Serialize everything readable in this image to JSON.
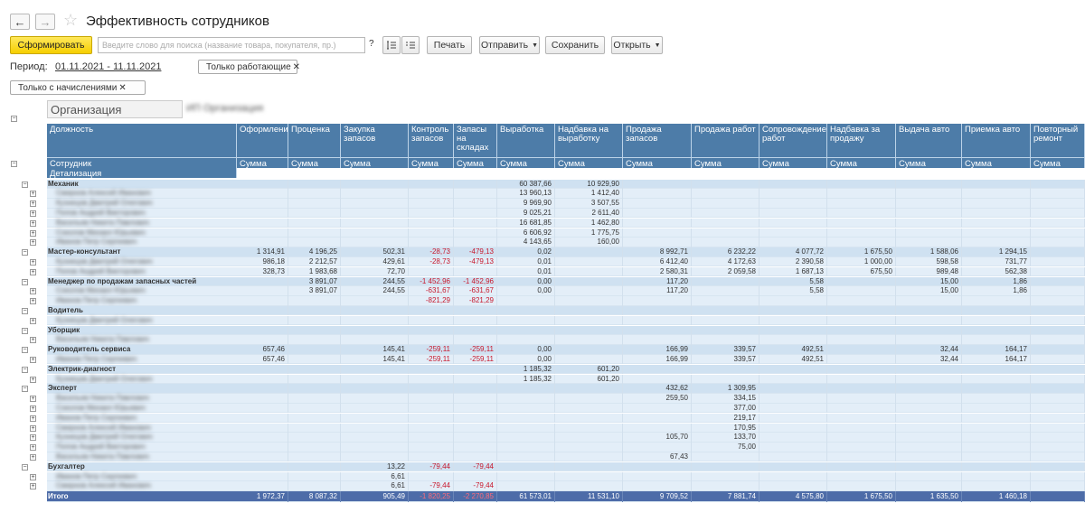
{
  "window": {
    "title": "Эффективность сотрудников"
  },
  "toolbar": {
    "generate": "Сформировать",
    "search_placeholder": "Введите слово для поиска (название товара, покупателя, пр.)",
    "help": "?",
    "print": "Печать",
    "send": "Отправить",
    "save": "Сохранить",
    "open": "Открыть"
  },
  "filters": {
    "period_label": "Период:",
    "period_value": "01.11.2021 - 11.11.2021",
    "only_working": "Только работающие",
    "only_accrued": "Только с начислениями"
  },
  "report": {
    "org_label": "Организация",
    "col_position": "Должность",
    "col_employee": "Сотрудник",
    "col_detail": "Детализация",
    "sum_label": "Сумма",
    "columns": [
      "Оформление",
      "Проценка",
      "Закупка запасов",
      "Контроль запасов",
      "Запасы на складах",
      "Выработка",
      "Надбавка на выработку",
      "Продажа запасов",
      "Продажа работ",
      "Сопровождение работ",
      "Надбавка за продажу",
      "Выдача авто",
      "Приемка авто",
      "Повторный ремонт"
    ],
    "rows": [
      {
        "kind": "group",
        "label": "Механик",
        "v": [
          "",
          "",
          "",
          "",
          "",
          "60 387,66",
          "10 929,90",
          "",
          "",
          "",
          "",
          "",
          "",
          ""
        ]
      },
      {
        "kind": "emp",
        "v": [
          "",
          "",
          "",
          "",
          "",
          "13 960,13",
          "1 412,40",
          "",
          "",
          "",
          "",
          "",
          "",
          ""
        ]
      },
      {
        "kind": "emp",
        "v": [
          "",
          "",
          "",
          "",
          "",
          "9 969,90",
          "3 507,55",
          "",
          "",
          "",
          "",
          "",
          "",
          ""
        ]
      },
      {
        "kind": "emp",
        "v": [
          "",
          "",
          "",
          "",
          "",
          "9 025,21",
          "2 611,40",
          "",
          "",
          "",
          "",
          "",
          "",
          ""
        ]
      },
      {
        "kind": "emp",
        "v": [
          "",
          "",
          "",
          "",
          "",
          "16 681,85",
          "1 462,80",
          "",
          "",
          "",
          "",
          "",
          "",
          ""
        ]
      },
      {
        "kind": "emp",
        "v": [
          "",
          "",
          "",
          "",
          "",
          "6 606,92",
          "1 775,75",
          "",
          "",
          "",
          "",
          "",
          "",
          ""
        ]
      },
      {
        "kind": "emp",
        "v": [
          "",
          "",
          "",
          "",
          "",
          "4 143,65",
          "160,00",
          "",
          "",
          "",
          "",
          "",
          "",
          ""
        ]
      },
      {
        "kind": "group",
        "label": "Мастер-консультант",
        "v": [
          "1 314,91",
          "4 196,25",
          "502,31",
          "-28,73",
          "-479,13",
          "0,02",
          "",
          "8 992,71",
          "6 232,22",
          "4 077,72",
          "1 675,50",
          "1 588,06",
          "1 294,15",
          ""
        ]
      },
      {
        "kind": "emp",
        "v": [
          "986,18",
          "2 212,57",
          "429,61",
          "-28,73",
          "-479,13",
          "0,01",
          "",
          "6 412,40",
          "4 172,63",
          "2 390,58",
          "1 000,00",
          "598,58",
          "731,77",
          ""
        ]
      },
      {
        "kind": "emp",
        "v": [
          "328,73",
          "1 983,68",
          "72,70",
          "",
          "",
          "0,01",
          "",
          "2 580,31",
          "2 059,58",
          "1 687,13",
          "675,50",
          "989,48",
          "562,38",
          ""
        ]
      },
      {
        "kind": "group",
        "label": "Менеджер по продажам запасных частей",
        "v": [
          "",
          "3 891,07",
          "244,55",
          "-1 452,96",
          "-1 452,96",
          "0,00",
          "",
          "117,20",
          "",
          "5,58",
          "",
          "15,00",
          "1,86",
          ""
        ]
      },
      {
        "kind": "emp",
        "v": [
          "",
          "3 891,07",
          "244,55",
          "-631,67",
          "-631,67",
          "0,00",
          "",
          "117,20",
          "",
          "5,58",
          "",
          "15,00",
          "1,86",
          ""
        ]
      },
      {
        "kind": "emp",
        "v": [
          "",
          "",
          "",
          "-821,29",
          "-821,29",
          "",
          "",
          "",
          "",
          "",
          "",
          "",
          "",
          ""
        ]
      },
      {
        "kind": "group",
        "label": "Водитель",
        "v": [
          "",
          "",
          "",
          "",
          "",
          "",
          "",
          "",
          "",
          "",
          "",
          "",
          "",
          ""
        ]
      },
      {
        "kind": "emp",
        "v": [
          "",
          "",
          "",
          "",
          "",
          "",
          "",
          "",
          "",
          "",
          "",
          "",
          "",
          ""
        ]
      },
      {
        "kind": "group",
        "label": "Уборщик",
        "v": [
          "",
          "",
          "",
          "",
          "",
          "",
          "",
          "",
          "",
          "",
          "",
          "",
          "",
          ""
        ]
      },
      {
        "kind": "emp",
        "v": [
          "",
          "",
          "",
          "",
          "",
          "",
          "",
          "",
          "",
          "",
          "",
          "",
          "",
          ""
        ]
      },
      {
        "kind": "group",
        "label": "Руководитель сервиса",
        "v": [
          "657,46",
          "",
          "145,41",
          "-259,11",
          "-259,11",
          "0,00",
          "",
          "166,99",
          "339,57",
          "492,51",
          "",
          "32,44",
          "164,17",
          ""
        ]
      },
      {
        "kind": "emp",
        "v": [
          "657,46",
          "",
          "145,41",
          "-259,11",
          "-259,11",
          "0,00",
          "",
          "166,99",
          "339,57",
          "492,51",
          "",
          "32,44",
          "164,17",
          ""
        ]
      },
      {
        "kind": "group",
        "label": "Электрик-диагност",
        "v": [
          "",
          "",
          "",
          "",
          "",
          "1 185,32",
          "601,20",
          "",
          "",
          "",
          "",
          "",
          "",
          ""
        ]
      },
      {
        "kind": "emp",
        "v": [
          "",
          "",
          "",
          "",
          "",
          "1 185,32",
          "601,20",
          "",
          "",
          "",
          "",
          "",
          "",
          ""
        ]
      },
      {
        "kind": "group",
        "label": "Эксперт",
        "v": [
          "",
          "",
          "",
          "",
          "",
          "",
          "",
          "432,62",
          "1 309,95",
          "",
          "",
          "",
          "",
          ""
        ]
      },
      {
        "kind": "emp",
        "v": [
          "",
          "",
          "",
          "",
          "",
          "",
          "",
          "259,50",
          "334,15",
          "",
          "",
          "",
          "",
          ""
        ]
      },
      {
        "kind": "emp",
        "v": [
          "",
          "",
          "",
          "",
          "",
          "",
          "",
          "",
          "377,00",
          "",
          "",
          "",
          "",
          ""
        ]
      },
      {
        "kind": "emp",
        "v": [
          "",
          "",
          "",
          "",
          "",
          "",
          "",
          "",
          "219,17",
          "",
          "",
          "",
          "",
          ""
        ]
      },
      {
        "kind": "emp",
        "v": [
          "",
          "",
          "",
          "",
          "",
          "",
          "",
          "",
          "170,95",
          "",
          "",
          "",
          "",
          ""
        ]
      },
      {
        "kind": "emp",
        "v": [
          "",
          "",
          "",
          "",
          "",
          "",
          "",
          "105,70",
          "133,70",
          "",
          "",
          "",
          "",
          ""
        ]
      },
      {
        "kind": "emp",
        "v": [
          "",
          "",
          "",
          "",
          "",
          "",
          "",
          "",
          "75,00",
          "",
          "",
          "",
          "",
          ""
        ]
      },
      {
        "kind": "emp",
        "v": [
          "",
          "",
          "",
          "",
          "",
          "",
          "",
          "67,43",
          "",
          "",
          "",
          "",
          "",
          ""
        ]
      },
      {
        "kind": "group",
        "label": "Бухгалтер",
        "v": [
          "",
          "",
          "13,22",
          "-79,44",
          "-79,44",
          "",
          "",
          "",
          "",
          "",
          "",
          "",
          "",
          ""
        ]
      },
      {
        "kind": "emp",
        "v": [
          "",
          "",
          "6,61",
          "",
          "",
          "",
          "",
          "",
          "",
          "",
          "",
          "",
          "",
          ""
        ]
      },
      {
        "kind": "emp",
        "v": [
          "",
          "",
          "6,61",
          "-79,44",
          "-79,44",
          "",
          "",
          "",
          "",
          "",
          "",
          "",
          "",
          ""
        ]
      },
      {
        "kind": "total",
        "label": "Итого",
        "v": [
          "1 972,37",
          "8 087,32",
          "905,49",
          "-1 820,25",
          "-2 270,85",
          "61 573,01",
          "11 531,10",
          "9 709,52",
          "7 881,74",
          "4 575,80",
          "1 675,50",
          "1 635,50",
          "1 460,18",
          ""
        ]
      }
    ]
  }
}
